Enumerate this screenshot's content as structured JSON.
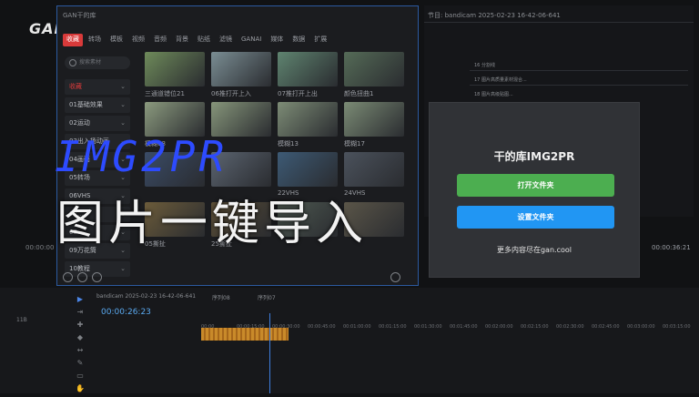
{
  "logo": "GAN.",
  "panel": {
    "title": "GAN干的库",
    "tabs": [
      "收藏",
      "转场",
      "模板",
      "视频",
      "音频",
      "背景",
      "贴纸",
      "滤镜",
      "GANAI",
      "媒体",
      "数据",
      "扩展"
    ],
    "active_tab_index": 0,
    "search_placeholder": "搜索素材",
    "categories": [
      {
        "label": "收藏",
        "active": true
      },
      {
        "label": "01基础效果",
        "active": false
      },
      {
        "label": "02运动",
        "active": false
      },
      {
        "label": "03出入场动画",
        "active": false
      },
      {
        "label": "04画面",
        "active": false
      },
      {
        "label": "05转场",
        "active": false
      },
      {
        "label": "06VHS",
        "active": false
      },
      {
        "label": "07...",
        "active": false
      },
      {
        "label": "08...",
        "active": false
      },
      {
        "label": "09万花筒",
        "active": false
      },
      {
        "label": "10教程",
        "active": false
      }
    ],
    "thumbnails": [
      {
        "label": "三通道错位21",
        "color": "#6e8a5a"
      },
      {
        "label": "06推打开上入",
        "color": "#7a8d93"
      },
      {
        "label": "07推打开上出",
        "color": "#5f8470"
      },
      {
        "label": "颜色扭曲1",
        "color": "#556b57"
      },
      {
        "label": "模糊08",
        "color": "#8b9a7e"
      },
      {
        "label": "",
        "color": "#86957a"
      },
      {
        "label": "模糊13",
        "color": "#7d8c76"
      },
      {
        "label": "模糊17",
        "color": "#7b8b75"
      },
      {
        "label": "",
        "color": "#3a4b66"
      },
      {
        "label": "",
        "color": "#5b6470"
      },
      {
        "label": "22VHS",
        "color": "#3d5a75"
      },
      {
        "label": "24VHS",
        "color": "#4b525c"
      },
      {
        "label": "05撕扯",
        "color": "#6b5b3a"
      },
      {
        "label": "25撕扯",
        "color": "#5a4d35"
      },
      {
        "label": "",
        "color": "#4f5a52"
      },
      {
        "label": "",
        "color": "#5a5548"
      }
    ]
  },
  "monitor": {
    "title": "节目: bandicam 2025-02-23 16-42-06-641",
    "rows": [
      "16  分割线",
      "17  图片高质量素材混合...",
      "18  图片高级贴图..."
    ],
    "timecode_right": "00:00:36:21",
    "timecode_left": "00:00:00"
  },
  "dialog": {
    "title": "干的库IMG2PR",
    "open_button": "打开文件夹",
    "settings_button": "设置文件夹",
    "footer": "更多内容尽在gan.cool"
  },
  "headline": {
    "line1": "IMG2PR",
    "line2": "图片一键导入"
  },
  "timeline": {
    "tab_label": "bandicam 2025-02-23 16-42-06-641",
    "tab2": "序列08",
    "tab3": "序列07",
    "timecode": "00:00:26:23",
    "left_label": "11B",
    "ruler_marks": [
      "00:00",
      "00:00:15:00",
      "00:00:30:00",
      "00:00:45:00",
      "00:01:00:00",
      "00:01:15:00",
      "00:01:30:00",
      "00:01:45:00",
      "00:02:00:00",
      "00:02:15:00",
      "00:02:30:00",
      "00:02:45:00",
      "00:03:00:00",
      "00:03:15:00"
    ]
  }
}
